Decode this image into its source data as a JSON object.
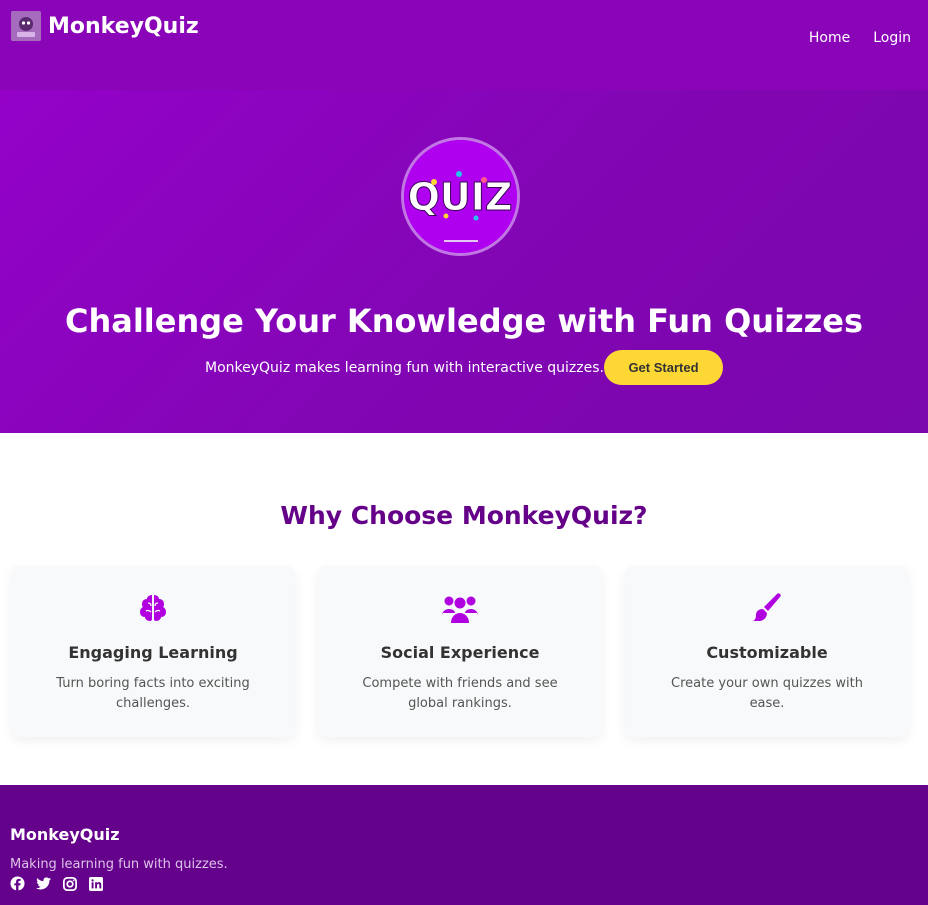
{
  "navbar": {
    "brand": "MonkeyQuiz",
    "links": [
      {
        "label": "Home"
      },
      {
        "label": "Login"
      }
    ]
  },
  "hero": {
    "logo_text": "QUIZ",
    "title": "Challenge Your Knowledge with Fun Quizzes",
    "subtitle": "MonkeyQuiz makes learning fun with interactive quizzes.",
    "cta_label": "Get Started"
  },
  "features": {
    "title": "Why Choose MonkeyQuiz?",
    "cards": [
      {
        "icon": "brain-icon",
        "title": "Engaging Learning",
        "description": "Turn boring facts into exciting challenges."
      },
      {
        "icon": "users-icon",
        "title": "Social Experience",
        "description": "Compete with friends and see global rankings."
      },
      {
        "icon": "paintbrush-icon",
        "title": "Customizable",
        "description": "Create your own quizzes with ease."
      }
    ]
  },
  "footer": {
    "brand": "MonkeyQuiz",
    "tagline": "Making learning fun with quizzes.",
    "social": [
      "facebook-icon",
      "twitter-icon",
      "instagram-icon",
      "linkedin-icon"
    ]
  },
  "colors": {
    "primary": "#8a05b8",
    "heading": "#650089",
    "accent": "#fdd835",
    "icon": "#b000e0",
    "footer": "#65028c"
  }
}
